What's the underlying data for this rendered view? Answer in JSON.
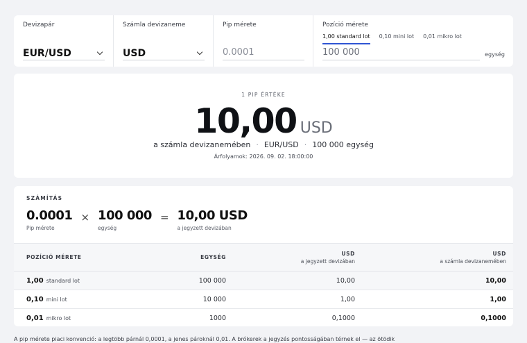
{
  "controls": {
    "pair": {
      "label": "Devizapár",
      "value": "EUR/USD"
    },
    "account_currency": {
      "label": "Számla devizaneme",
      "value": "USD"
    },
    "pip_size": {
      "label": "Pip mérete",
      "placeholder": "0.0001"
    },
    "position": {
      "label": "Pozíció mérete",
      "tabs": [
        {
          "label": "1,00 standard lot",
          "active": true
        },
        {
          "label": "0,10 mini lot",
          "active": false
        },
        {
          "label": "0,01 mikro lot",
          "active": false
        }
      ],
      "value": "100 000",
      "unit": "egység"
    }
  },
  "result": {
    "eyebrow": "1 PIP ÉRTÉKE",
    "value": "10,00",
    "currency": "USD",
    "meta": [
      "a számla devizanemében",
      "EUR/USD",
      "100 000 egység"
    ],
    "separator": "·",
    "rates": "Árfolyamok: 2026. 09. 02. 18:00:00"
  },
  "calc": {
    "title": "SZÁMÍTÁS",
    "terms": [
      {
        "value": "0.0001",
        "label": "Pip mérete"
      },
      {
        "value": "100 000",
        "label": "egység"
      },
      {
        "value": "10,00 USD",
        "label": "a jegyzett devizában"
      }
    ],
    "ops": [
      "×",
      "="
    ],
    "table": {
      "headers": [
        {
          "title": "POZÍCIÓ MÉRETE",
          "sub": ""
        },
        {
          "title": "EGYSÉG",
          "sub": ""
        },
        {
          "title": "USD",
          "sub": "a jegyzett devizában"
        },
        {
          "title": "USD",
          "sub": "a számla devizanemében"
        }
      ],
      "rows": [
        {
          "lot": "1,00",
          "name": "standard lot",
          "units": "100 000",
          "quote": "10,00",
          "account": "10,00",
          "highlight": true
        },
        {
          "lot": "0,10",
          "name": "mini lot",
          "units": "10 000",
          "quote": "1,00",
          "account": "1,00",
          "highlight": false
        },
        {
          "lot": "0,01",
          "name": "mikro lot",
          "units": "1000",
          "quote": "0,1000",
          "account": "0,1000",
          "highlight": false
        }
      ]
    }
  },
  "footnote": "A pip mérete piaci konvenció: a legtöbb párnál 0,0001, a jenes pároknál 0,01. A brókerek a jegyzés pontosságában térnek el — az ötödik"
}
